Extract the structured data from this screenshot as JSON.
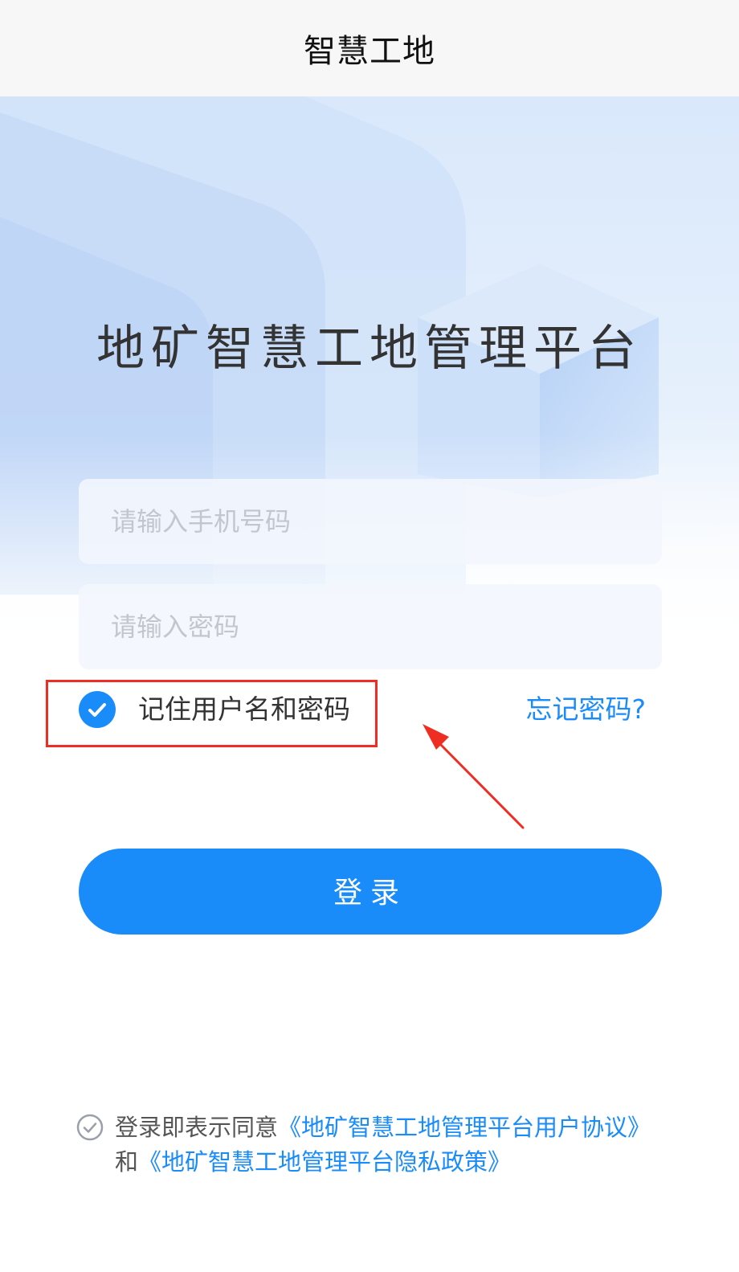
{
  "nav": {
    "title": "智慧工地"
  },
  "platform_title": "地矿智慧工地管理平台",
  "login_form": {
    "phone_placeholder": "请输入手机号码",
    "phone_value": "",
    "password_placeholder": "请输入密码",
    "password_value": "",
    "remember_label": "记住用户名和密码",
    "remember_checked": true,
    "forgot_label": "忘记密码?",
    "login_label": "登录"
  },
  "agreement": {
    "prefix": "登录即表示同意",
    "user_agreement": "《地矿智慧工地管理平台用户协议》",
    "conjunction": "和",
    "privacy_policy": "《地矿智慧工地管理平台隐私政策》"
  },
  "colors": {
    "primary": "#1a8cfa",
    "annotation": "#ee2e22",
    "title_text": "#333333",
    "placeholder": "#c2c6cf"
  },
  "icons": {
    "remember": "check-circle-icon",
    "agreement": "check-outline-circle-icon"
  }
}
